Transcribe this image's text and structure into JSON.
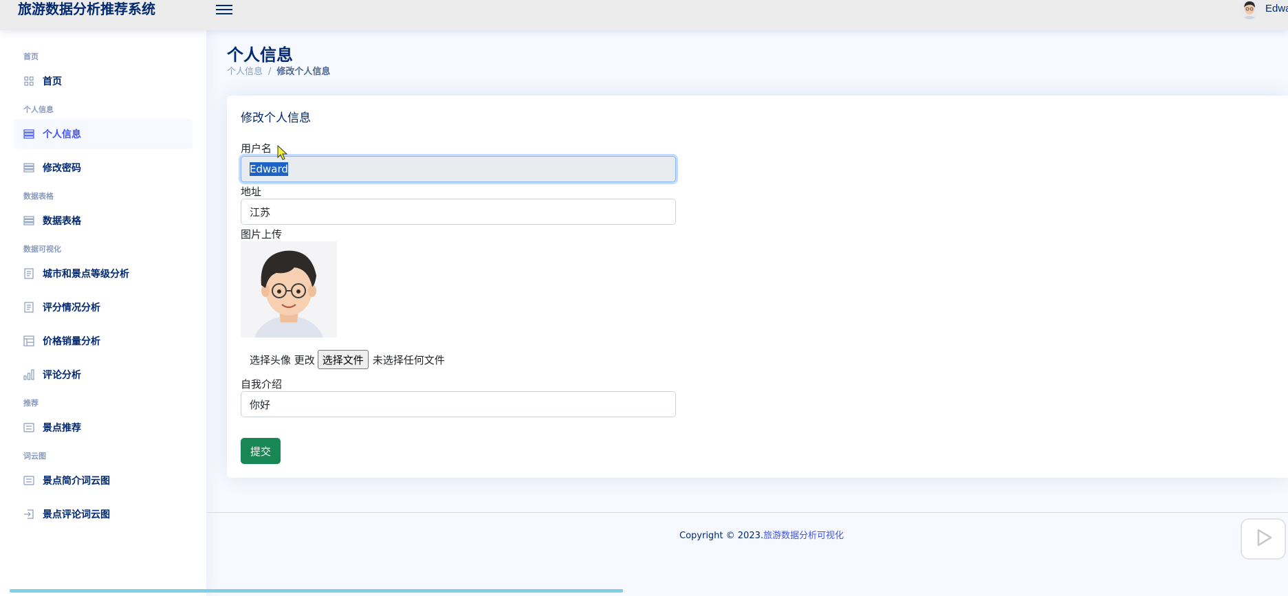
{
  "header": {
    "brand": "旅游数据分析推荐系统",
    "user_name": "Edwa"
  },
  "sidebar": {
    "sections": [
      {
        "heading": "首页",
        "items": [
          {
            "label": "首页",
            "icon": "grid-icon",
            "active": false
          }
        ]
      },
      {
        "heading": "个人信息",
        "items": [
          {
            "label": "个人信息",
            "icon": "list-icon",
            "active": true
          },
          {
            "label": "修改密码",
            "icon": "list-icon",
            "active": false
          }
        ]
      },
      {
        "heading": "数据表格",
        "items": [
          {
            "label": "数据表格",
            "icon": "list-icon",
            "active": false
          }
        ]
      },
      {
        "heading": "数据可视化",
        "items": [
          {
            "label": "城市和景点等级分析",
            "icon": "document-icon",
            "active": false
          },
          {
            "label": "评分情况分析",
            "icon": "document-icon",
            "active": false
          },
          {
            "label": "价格销量分析",
            "icon": "table-icon",
            "active": false
          },
          {
            "label": "评论分析",
            "icon": "bar-chart-icon",
            "active": false
          }
        ]
      },
      {
        "heading": "推荐",
        "items": [
          {
            "label": "景点推荐",
            "icon": "card-list-icon",
            "active": false
          }
        ]
      },
      {
        "heading": "词云图",
        "items": [
          {
            "label": "景点简介词云图",
            "icon": "card-list-icon",
            "active": false
          },
          {
            "label": "景点评论词云图",
            "icon": "login-icon",
            "active": false
          }
        ]
      }
    ]
  },
  "page": {
    "title": "个人信息",
    "breadcrumb": [
      "个人信息",
      "修改个人信息"
    ]
  },
  "form": {
    "card_title": "修改个人信息",
    "username_label": "用户名",
    "username_value": "Edward",
    "address_label": "地址",
    "address_value": "江苏",
    "image_label": "图片上传",
    "avatar_label": "选择头像 更改",
    "file_button": "选择文件",
    "file_status": "未选择任何文件",
    "bio_label": "自我介绍",
    "bio_value": "你好",
    "submit": "提交"
  },
  "footer": {
    "copyright": "Copyright © 2023.",
    "link": "旅游数据分析可视化"
  },
  "video_progress": 0.48,
  "colors": {
    "primary": "#012970",
    "accent": "#4154f1",
    "submit": "#198754",
    "selection": "#1c62c7"
  }
}
